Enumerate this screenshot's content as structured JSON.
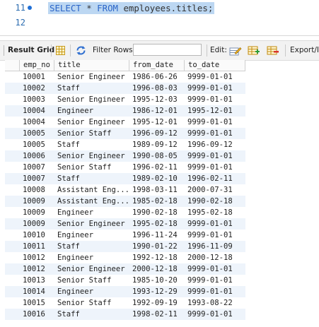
{
  "editor": {
    "lines": [
      {
        "number": "11",
        "kw1": "SELECT",
        "mid": " * ",
        "kw2": "FROM",
        "rest": " employees.titles;"
      },
      {
        "number": "12"
      }
    ]
  },
  "toolbar": {
    "title": "Result Grid",
    "filter_label": "Filter Rows:",
    "filter_value": "",
    "edit_label": "Edit:",
    "export_label": "Export/Im"
  },
  "grid": {
    "columns": [
      "emp_no",
      "title",
      "from_date",
      "to_date"
    ],
    "rows": [
      [
        "10001",
        "Senior Engineer",
        "1986-06-26",
        "9999-01-01"
      ],
      [
        "10002",
        "Staff",
        "1996-08-03",
        "9999-01-01"
      ],
      [
        "10003",
        "Senior Engineer",
        "1995-12-03",
        "9999-01-01"
      ],
      [
        "10004",
        "Engineer",
        "1986-12-01",
        "1995-12-01"
      ],
      [
        "10004",
        "Senior Engineer",
        "1995-12-01",
        "9999-01-01"
      ],
      [
        "10005",
        "Senior Staff",
        "1996-09-12",
        "9999-01-01"
      ],
      [
        "10005",
        "Staff",
        "1989-09-12",
        "1996-09-12"
      ],
      [
        "10006",
        "Senior Engineer",
        "1990-08-05",
        "9999-01-01"
      ],
      [
        "10007",
        "Senior Staff",
        "1996-02-11",
        "9999-01-01"
      ],
      [
        "10007",
        "Staff",
        "1989-02-10",
        "1996-02-11"
      ],
      [
        "10008",
        "Assistant Eng...",
        "1998-03-11",
        "2000-07-31"
      ],
      [
        "10009",
        "Assistant Eng...",
        "1985-02-18",
        "1990-02-18"
      ],
      [
        "10009",
        "Engineer",
        "1990-02-18",
        "1995-02-18"
      ],
      [
        "10009",
        "Senior Engineer",
        "1995-02-18",
        "9999-01-01"
      ],
      [
        "10010",
        "Engineer",
        "1996-11-24",
        "9999-01-01"
      ],
      [
        "10011",
        "Staff",
        "1990-01-22",
        "1996-11-09"
      ],
      [
        "10012",
        "Engineer",
        "1992-12-18",
        "2000-12-18"
      ],
      [
        "10012",
        "Senior Engineer",
        "2000-12-18",
        "9999-01-01"
      ],
      [
        "10013",
        "Senior Staff",
        "1985-10-20",
        "9999-01-01"
      ],
      [
        "10014",
        "Engineer",
        "1993-12-29",
        "9999-01-01"
      ],
      [
        "10015",
        "Senior Staff",
        "1992-09-19",
        "1993-08-22"
      ],
      [
        "10016",
        "Staff",
        "1998-02-11",
        "9999-01-01"
      ]
    ]
  }
}
